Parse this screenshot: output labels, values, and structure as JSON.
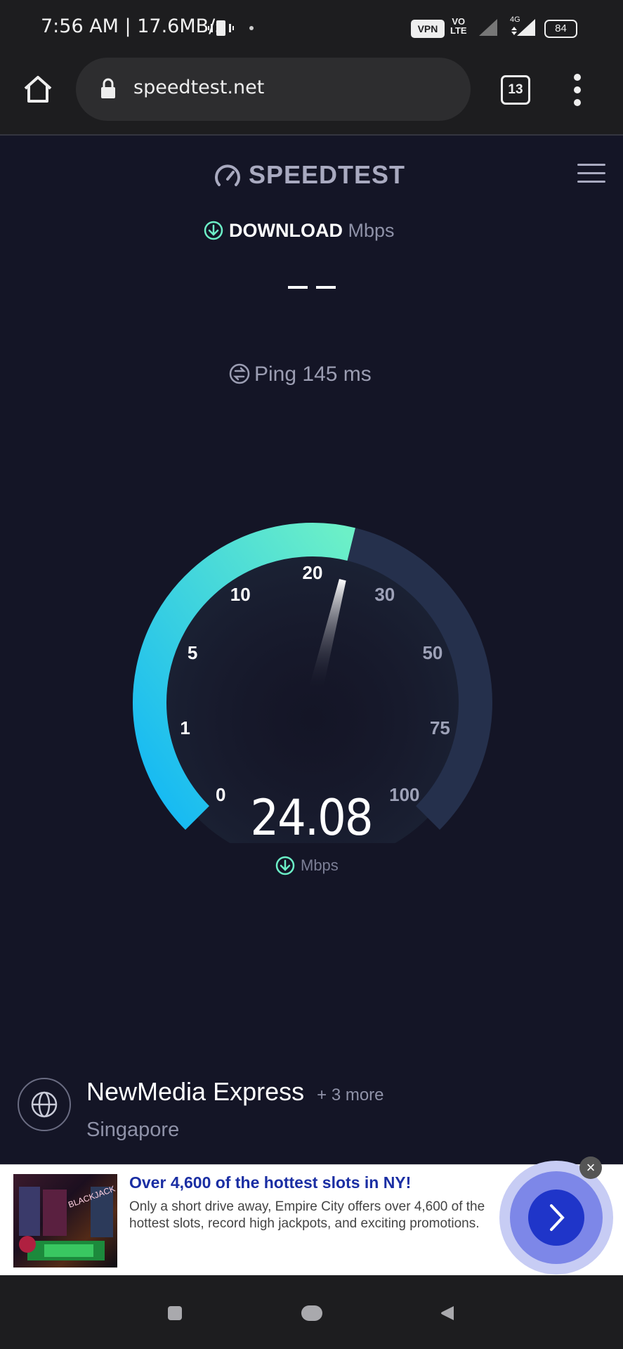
{
  "status_bar": {
    "time_and_speed": "7:56 AM | 17.6MB/s",
    "vpn": "VPN",
    "volte_top": "VO",
    "volte_bottom": "LTE",
    "network": "4G",
    "battery": "84"
  },
  "browser": {
    "url": "speedtest.net",
    "tab_count": "13"
  },
  "speedtest": {
    "logo_text": "SPEEDTEST",
    "download_label": "DOWNLOAD",
    "download_unit": "Mbps",
    "ping_label": "Ping",
    "ping_value": "145",
    "ping_unit": "ms",
    "gauge_ticks": [
      "0",
      "1",
      "5",
      "10",
      "20",
      "30",
      "50",
      "75",
      "100"
    ],
    "current_speed": "24.08",
    "speed_unit": "Mbps",
    "server_name": "NewMedia Express",
    "server_more": "+ 3 more",
    "server_location": "Singapore",
    "accent_gradient": [
      "#12b7f5",
      "#6cf0c7"
    ]
  },
  "ad": {
    "title": "Over 4,600 of the hottest slots in NY!",
    "body": "Only a short drive away, Empire City offers over 4,600 of the hottest slots, record high jackpots, and exciting promotions.",
    "close": "×",
    "image_text": "BLACKJACK"
  },
  "icons": {
    "home": "home-icon",
    "lock": "lock-icon",
    "menu": "more-vert-icon",
    "hamburger": "hamburger-icon",
    "download": "download-arrow-icon",
    "ping": "ping-icon",
    "globe": "globe-icon",
    "cta": "chevron-right-icon"
  }
}
